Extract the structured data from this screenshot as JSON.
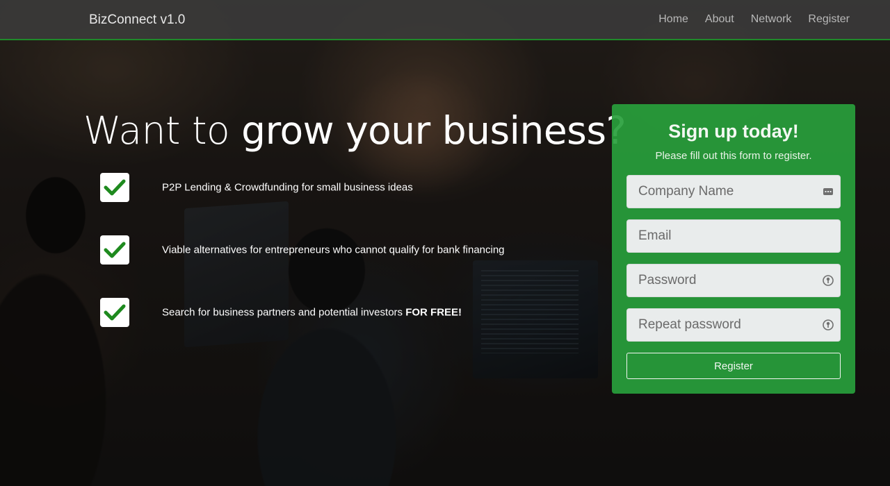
{
  "navbar": {
    "brand": "BizConnect v1.0",
    "links": [
      {
        "label": "Home"
      },
      {
        "label": "About"
      },
      {
        "label": "Network"
      },
      {
        "label": "Register"
      }
    ],
    "accent_color": "#1f8a2a"
  },
  "hero": {
    "title_light": "Want to ",
    "title_bold": "grow your business?",
    "features": [
      {
        "text": "P2P Lending & Crowdfunding for small business ideas",
        "bold": ""
      },
      {
        "text": "Viable alternatives for entrepreneurs who cannot qualify for bank financing",
        "bold": ""
      },
      {
        "text": "Search for business partners and potential investors ",
        "bold": "FOR FREE!"
      }
    ],
    "check_color": "#1e8a1e"
  },
  "signup": {
    "title": "Sign up today!",
    "subtitle": "Please fill out this form to register.",
    "fields": [
      {
        "placeholder": "Company Name",
        "value": "",
        "icon": "contact-card-icon"
      },
      {
        "placeholder": "Email",
        "value": "",
        "icon": ""
      },
      {
        "placeholder": "Password",
        "value": "",
        "icon": "key-icon"
      },
      {
        "placeholder": "Repeat password",
        "value": "",
        "icon": "key-icon"
      }
    ],
    "button_label": "Register",
    "card_color": "#28a03c"
  }
}
